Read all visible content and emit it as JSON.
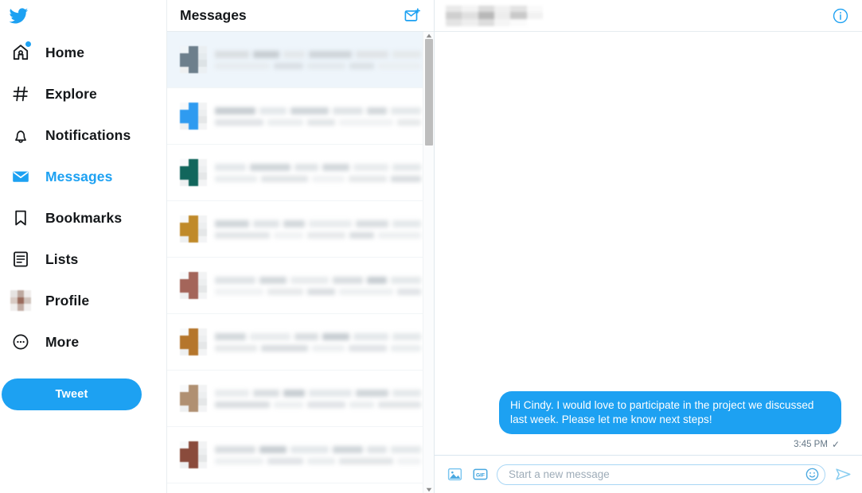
{
  "brand": {
    "name": "Twitter",
    "accent": "#1DA1F2",
    "logo_icon": "twitter-bird-icon",
    "text_dark": "#14171A",
    "muted": "#657786"
  },
  "sidebar": {
    "items": [
      {
        "label": "Home",
        "icon": "home-icon",
        "active": false,
        "badge": true
      },
      {
        "label": "Explore",
        "icon": "hashtag-icon",
        "active": false,
        "badge": false
      },
      {
        "label": "Notifications",
        "icon": "bell-icon",
        "active": false,
        "badge": false
      },
      {
        "label": "Messages",
        "icon": "envelope-icon",
        "active": true,
        "badge": false
      },
      {
        "label": "Bookmarks",
        "icon": "bookmark-icon",
        "active": false,
        "badge": false
      },
      {
        "label": "Lists",
        "icon": "list-icon",
        "active": false,
        "badge": false
      },
      {
        "label": "Profile",
        "icon": "profile-avatar-icon",
        "active": false,
        "badge": false
      },
      {
        "label": "More",
        "icon": "more-circle-icon",
        "active": false,
        "badge": false
      }
    ],
    "tweet_button": "Tweet"
  },
  "message_list": {
    "title": "Messages",
    "new_message_icon": "new-message-envelope-icon",
    "scrollbar": {
      "up_arrow_icon": "scroll-up-arrow-icon",
      "down_arrow_icon": "scroll-down-arrow-icon"
    },
    "conversations": [
      {
        "selected": true,
        "avatar_color": "#6d7f8c",
        "name_redacted": true,
        "preview_redacted": true,
        "time_redacted": true
      },
      {
        "selected": false,
        "avatar_color": "#2f9bf0",
        "name_redacted": true,
        "preview_redacted": true,
        "time_redacted": true
      },
      {
        "selected": false,
        "avatar_color": "#11665c",
        "name_redacted": true,
        "preview_redacted": true,
        "time_redacted": true
      },
      {
        "selected": false,
        "avatar_color": "#c08a2a",
        "name_redacted": true,
        "preview_redacted": true,
        "time_redacted": true
      },
      {
        "selected": false,
        "avatar_color": "#a4655a",
        "name_redacted": true,
        "preview_redacted": true,
        "time_redacted": true
      },
      {
        "selected": false,
        "avatar_color": "#b5762c",
        "name_redacted": true,
        "preview_redacted": true,
        "time_redacted": true
      },
      {
        "selected": false,
        "avatar_color": "#b09072",
        "name_redacted": true,
        "preview_redacted": true,
        "time_redacted": true
      },
      {
        "selected": false,
        "avatar_color": "#8a4b3c",
        "name_redacted": true,
        "preview_redacted": true,
        "time_redacted": true
      }
    ]
  },
  "conversation": {
    "header": {
      "name_redacted": true,
      "info_icon": "info-circle-icon"
    },
    "messages": [
      {
        "outgoing": true,
        "text": "Hi Cindy. I would love to participate in the project we discussed last week. Please let me know next steps!",
        "time": "3:45 PM",
        "status_icon": "sent-check-icon",
        "status_glyph": "✓"
      }
    ]
  },
  "composer": {
    "media_icon": "image-upload-icon",
    "gif_icon": "gif-icon",
    "gif_label": "GIF",
    "placeholder": "Start a new message",
    "value": "",
    "emoji_icon": "emoji-smiley-icon",
    "send_icon": "send-plane-icon"
  }
}
